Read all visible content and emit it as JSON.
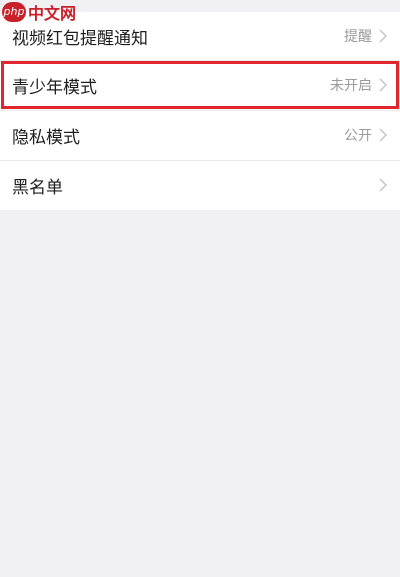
{
  "watermark": {
    "badge": "php",
    "text": "中文网"
  },
  "settings": {
    "items": [
      {
        "label": "视频红包提醒通知",
        "value": "提醒"
      },
      {
        "label": "青少年模式",
        "value": "未开启"
      },
      {
        "label": "隐私模式",
        "value": "公开"
      },
      {
        "label": "黑名单",
        "value": ""
      }
    ]
  },
  "colors": {
    "highlight": "#e2262f",
    "background": "#f1f1f3",
    "watermark": "#c9212a"
  },
  "icons": {
    "row_arrow": "chevron-right-icon",
    "watermark_logo": "php-logo"
  }
}
